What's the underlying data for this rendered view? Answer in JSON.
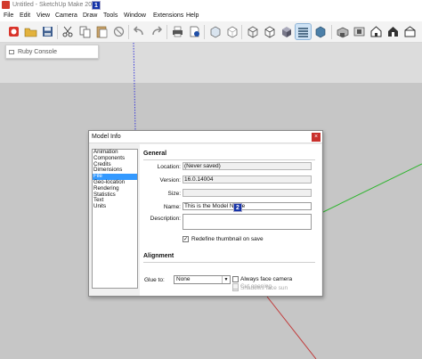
{
  "window": {
    "title": "Untitled - SketchUp Make 2016"
  },
  "menu": [
    "File",
    "Edit",
    "View",
    "Camera",
    "Draw",
    "Tools",
    "Window",
    "Extensions",
    "Help"
  ],
  "step_badges": {
    "menu": "1",
    "field": "2"
  },
  "ruby_console": {
    "label": "Ruby Console"
  },
  "colors": {
    "accent": "#3399ff",
    "badge": "#1433a8",
    "close": "#c9302c",
    "blue_axis": "#3a3ad8",
    "green_axis": "#2fb52f",
    "red_axis": "#c23a3a"
  },
  "dialog": {
    "title": "Model Info",
    "close_glyph": "×",
    "nav": [
      "Animation",
      "Components",
      "Credits",
      "Dimensions",
      "File",
      "Geo-location",
      "Rendering",
      "Statistics",
      "Text",
      "Units"
    ],
    "nav_selected": "File",
    "general": {
      "heading": "General",
      "location_label": "Location:",
      "location_value": "(Never saved)",
      "version_label": "Version:",
      "version_value": "16.0.14004",
      "size_label": "Size:",
      "size_value": "",
      "name_label": "Name:",
      "name_value": "This is the Model Name",
      "description_label": "Description:",
      "description_value": "",
      "redefine_label": "Redefine thumbnail on save",
      "redefine_checked": true
    },
    "alignment": {
      "heading": "Alignment",
      "glue_label": "Glue to:",
      "glue_value": "None",
      "always_face_label": "Always face camera",
      "shadows_label": "Shadows face sun",
      "cut_label": "Cut opening"
    }
  }
}
